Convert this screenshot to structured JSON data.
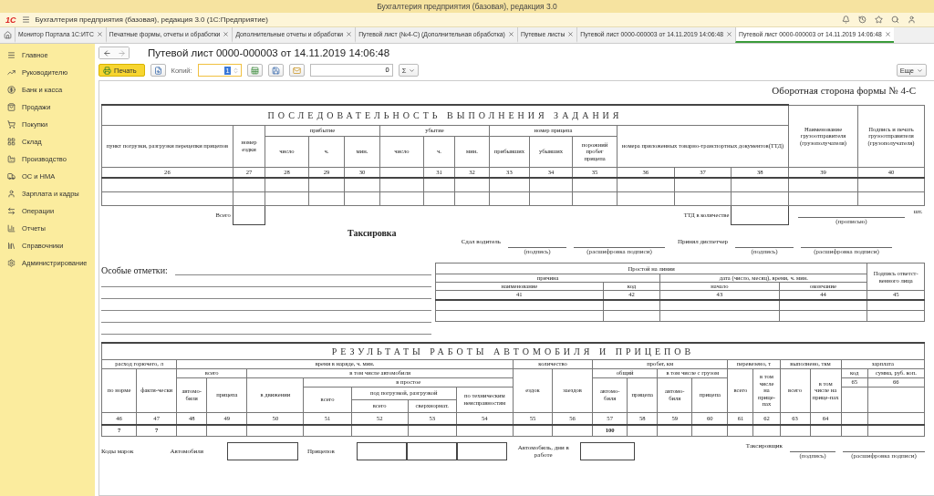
{
  "window": {
    "title": "Бухгалтерия предприятия (базовая), редакция 3.0"
  },
  "app_bar": {
    "logo": "1С",
    "title": "Бухгалтерия предприятия (базовая), редакция 3.0  (1С:Предприятие)"
  },
  "tabs": [
    {
      "label": "Монитор Портала 1С:ИТС",
      "selected": false
    },
    {
      "label": "Печатные формы, отчеты и обработки",
      "selected": false
    },
    {
      "label": "Дополнительные отчеты и обработки",
      "selected": false
    },
    {
      "label": "Путевой лист (№4-С) (Дополнительная обработка)",
      "selected": false
    },
    {
      "label": "Путевые листы",
      "selected": false
    },
    {
      "label": "Путевой лист 0000-000003 от 14.11.2019 14:06:48",
      "selected": false
    },
    {
      "label": "Путевой лист 0000-000003 от 14.11.2019 14:06:48",
      "selected": true
    }
  ],
  "sidebar": {
    "items": [
      "Главное",
      "Руководителю",
      "Банк и касса",
      "Продажи",
      "Покупки",
      "Склад",
      "Производство",
      "ОС и НМА",
      "Зарплата и кадры",
      "Операции",
      "Отчеты",
      "Справочники",
      "Администрирование"
    ]
  },
  "document": {
    "title": "Путевой лист 0000-000003 от 14.11.2019 14:06:48",
    "toolbar": {
      "print_button": "Печать",
      "copies_label": "Копий:",
      "copies_value": "1",
      "number_value": "0",
      "sum_button": "Σ",
      "more_button": "Еще"
    }
  },
  "form": {
    "caption": "Оборотная сторона формы № 4-С",
    "task_table": {
      "header_rows": [
        [
          "ПОСЛЕДОВАТЕЛЬНОСТЬ ВЫПОЛНЕНИЯ ЗАДАНИЯ",
          "Наименование грузоотправителя (грузополучателя)",
          "Подпись и печать грузоотправителя (грузополучателя)"
        ],
        [
          "пункт погрузки, разгрузки перецепки прицепов",
          "номер ездки",
          "прибытие",
          "убытие",
          "номер прицепа",
          "номера приложенных товарно-транспортных документов(ТТД)"
        ],
        [
          "число",
          "ч.",
          "мин.",
          "число",
          "ч.",
          "мин.",
          "прибывших",
          "убывших",
          "порожний пробег прицепа"
        ]
      ],
      "number_row": [
        "26",
        "27",
        "28",
        "29",
        "30",
        "31",
        "32",
        "33",
        "34",
        "35",
        "36",
        "37",
        "38",
        "39",
        "40"
      ],
      "total_row": [
        "Всего",
        "ТТД в количестве",
        "(прописью)",
        "шт."
      ]
    },
    "taxation": {
      "title": "Таксировка",
      "signatures": [
        {
          "label": "Сдал водитель",
          "captions": [
            "(подпись)",
            "(расшифровка подписи)"
          ]
        },
        {
          "label": "Принял диспетчер",
          "captions": [
            "(подпись)",
            "(расшифровка подписи)"
          ]
        }
      ]
    },
    "notes": {
      "label": "Особые отметки:"
    },
    "downtime_table": {
      "header_rows": [
        [
          "Простой на линии",
          "Подпись ответст-венного лица"
        ],
        [
          "причина",
          "дата (число, месяц), время, ч. мин."
        ],
        [
          "наименование",
          "код",
          "начало",
          "окончание"
        ]
      ],
      "number_row": [
        "41",
        "42",
        "43",
        "44",
        "45"
      ]
    },
    "results_table": {
      "header_rows": [
        [
          "РЕЗУЛЬТАТЫ РАБОТЫ АВТОМОБИЛЯ И ПРИЦЕПОВ"
        ],
        [
          "расход горючего, л",
          "время в наряде, ч. мин.",
          "количество",
          "пробег, км",
          "перевезено, т",
          "выполнено, ткм",
          "зарплата"
        ],
        [
          "по норме",
          "факти-чески",
          "всего",
          "в том числе автомобиля",
          "ездок",
          "заездов",
          "общий",
          "в том числе с грузом",
          "всего",
          "в том числе на прице-пах",
          "всего",
          "в том числе на прице-пах",
          "код",
          "сумма, руб. коп."
        ],
        [
          "автомо-биля",
          "прицепа",
          "в движении",
          "в простое",
          "автомо-биля",
          "прицепа",
          "автомо-биля",
          "прицепа",
          "65",
          "66"
        ],
        [
          "всего",
          "под погрузкой, разгрузкой",
          "по техническим неисправностям"
        ],
        [
          "всего",
          "сверхнормат."
        ]
      ],
      "number_row": [
        "46",
        "47",
        "48",
        "49",
        "50",
        "51",
        "52",
        "53",
        "54",
        "55",
        "56",
        "57",
        "58",
        "59",
        "60",
        "61",
        "62",
        "63",
        "64"
      ],
      "totals_row": [
        "7",
        "7",
        "100"
      ]
    },
    "footer": {
      "codes_label": "Коды марок",
      "vehicle_label": "Автомобиля",
      "trailers_label": "Прицепов",
      "days_label": "Автомобиль, дни в работе",
      "signer": {
        "label": "Таксировщик",
        "captions": [
          "(подпись)",
          "(расшифровка подписи)"
        ]
      }
    }
  }
}
